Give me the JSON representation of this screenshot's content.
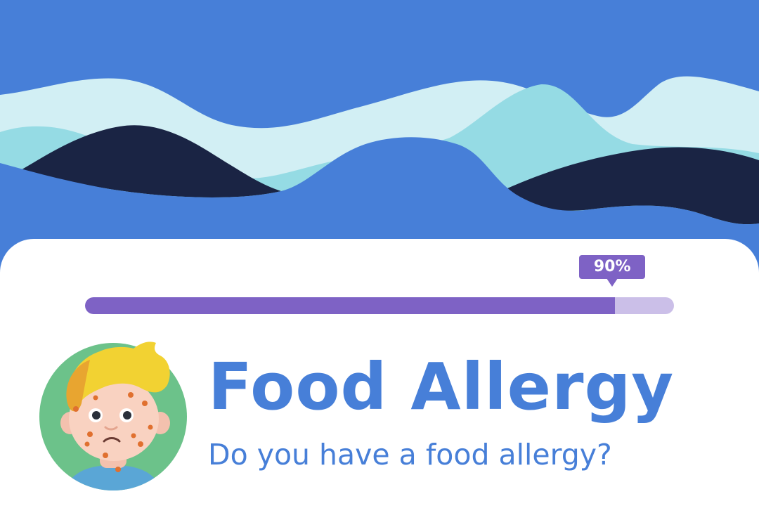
{
  "progress": {
    "percent": 90,
    "label": "90%"
  },
  "heading": {
    "title": "Food Allergy",
    "subtitle": "Do you have a food allergy?"
  },
  "colors": {
    "background_blue": "#477fd8",
    "wave_light": "#d2eff4",
    "wave_teal": "#95dbe4",
    "wave_navy": "#1a2444",
    "progress_fill": "#7e62c5",
    "progress_track": "#cbbfe8",
    "card": "#ffffff"
  },
  "icons": {
    "avatar": "allergic-boy-avatar-icon"
  }
}
